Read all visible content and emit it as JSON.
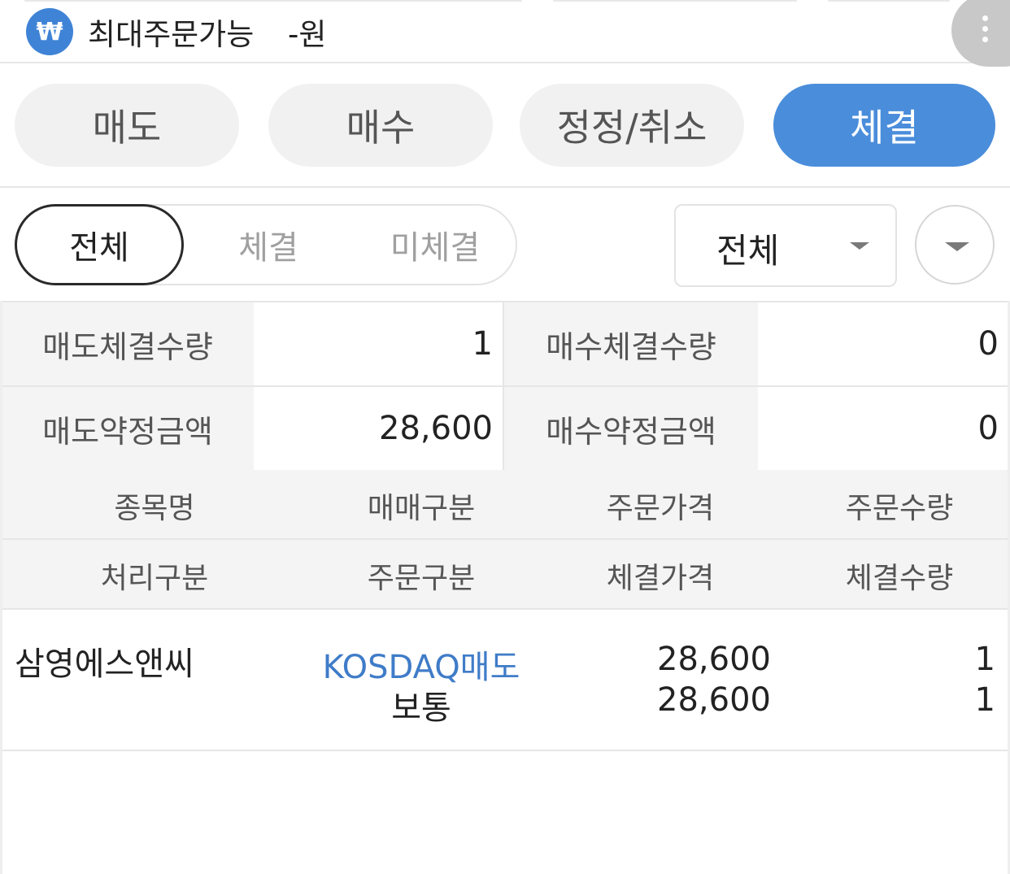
{
  "header": {
    "currency_icon": "won-icon",
    "currency_symbol": "₩",
    "max_order_label": "최대주문가능",
    "max_order_value": "-원",
    "more_icon": "more-vertical-icon"
  },
  "main_tabs": [
    {
      "label": "매도",
      "active": false
    },
    {
      "label": "매수",
      "active": false
    },
    {
      "label": "정정/취소",
      "active": false
    },
    {
      "label": "체결",
      "active": true
    }
  ],
  "filter": {
    "segments": [
      {
        "label": "전체",
        "active": true
      },
      {
        "label": "체결",
        "active": false
      },
      {
        "label": "미체결",
        "active": false
      }
    ],
    "select_value": "전체",
    "dropdown_icon": "chevron-down-icon"
  },
  "summary": {
    "sell_filled_qty_label": "매도체결수량",
    "sell_filled_qty": "1",
    "buy_filled_qty_label": "매수체결수량",
    "buy_filled_qty": "0",
    "sell_contract_amount_label": "매도약정금액",
    "sell_contract_amount": "28,600",
    "buy_contract_amount_label": "매수약정금액",
    "buy_contract_amount": "0"
  },
  "columns": {
    "row1": [
      "종목명",
      "매매구분",
      "주문가격",
      "주문수량"
    ],
    "row2": [
      "처리구분",
      "주문구분",
      "체결가격",
      "체결수량"
    ]
  },
  "orders": [
    {
      "stock_name": "삼영에스앤씨",
      "trade_type": "KOSDAQ매도",
      "order_type": "보통",
      "order_price": "28,600",
      "filled_price": "28,600",
      "order_qty": "1",
      "filled_qty": "1"
    }
  ],
  "colors": {
    "accent": "#4a8ddb",
    "trade_type_text": "#3f7cc8",
    "label_bg": "#f4f4f4"
  }
}
